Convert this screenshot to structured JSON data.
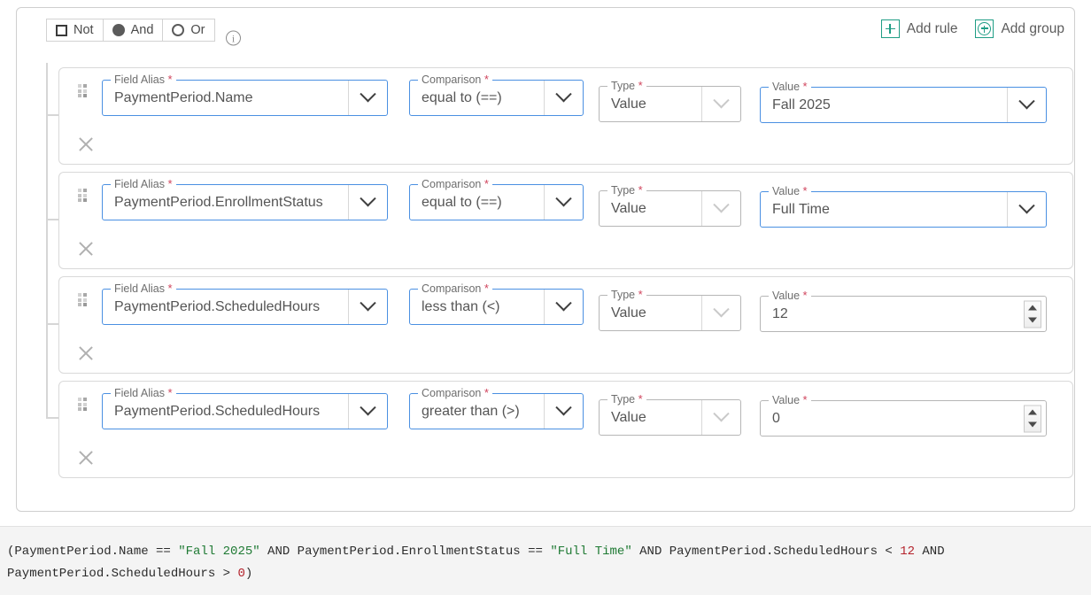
{
  "group": {
    "logic": {
      "not_label": "Not",
      "and_label": "And",
      "or_label": "Or",
      "not_checked": false,
      "selected": "And"
    },
    "info_icon": "info-icon",
    "actions": {
      "add_rule_label": "Add rule",
      "add_group_label": "Add group",
      "accent_color": "#1f9d85"
    }
  },
  "labels": {
    "field_alias": "Field Alias",
    "comparison": "Comparison",
    "type": "Type",
    "value": "Value",
    "required_mark": "*"
  },
  "rules": [
    {
      "field_alias": "PaymentPeriod.Name",
      "comparison": "equal to (==)",
      "type": "Value",
      "value": "Fall 2025",
      "value_control": "select"
    },
    {
      "field_alias": "PaymentPeriod.EnrollmentStatus",
      "comparison": "equal to (==)",
      "type": "Value",
      "value": "Full Time",
      "value_control": "select"
    },
    {
      "field_alias": "PaymentPeriod.ScheduledHours",
      "comparison": "less than (<)",
      "type": "Value",
      "value": "12",
      "value_control": "number"
    },
    {
      "field_alias": "PaymentPeriod.ScheduledHours",
      "comparison": "greater than (>)",
      "type": "Value",
      "value": "0",
      "value_control": "number"
    }
  ],
  "expression": {
    "tokens": [
      {
        "t": "(PaymentPeriod.Name == ",
        "k": "plain"
      },
      {
        "t": "\"Fall 2025\"",
        "k": "string"
      },
      {
        "t": " AND PaymentPeriod.EnrollmentStatus == ",
        "k": "plain"
      },
      {
        "t": "\"Full Time\"",
        "k": "string"
      },
      {
        "t": " AND PaymentPeriod.ScheduledHours < ",
        "k": "plain"
      },
      {
        "t": "12",
        "k": "number"
      },
      {
        "t": " AND PaymentPeriod.ScheduledHours > ",
        "k": "plain"
      },
      {
        "t": "0",
        "k": "number"
      },
      {
        "t": ")",
        "k": "plain"
      }
    ],
    "text": "(PaymentPeriod.Name == \"Fall 2025\" AND PaymentPeriod.EnrollmentStatus == \"Full Time\" AND PaymentPeriod.ScheduledHours < 12 AND PaymentPeriod.ScheduledHours > 0)"
  }
}
